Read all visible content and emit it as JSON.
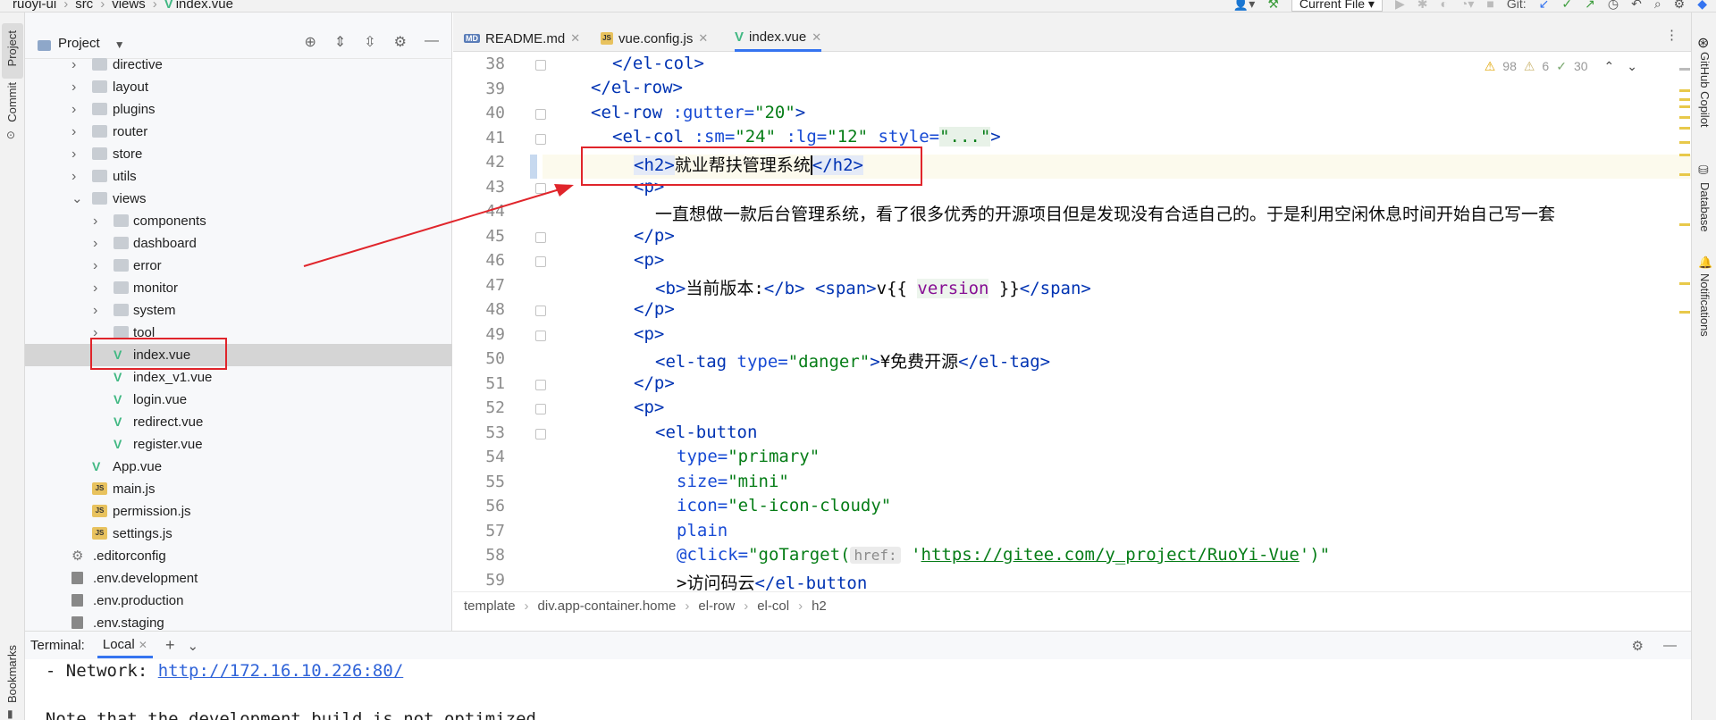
{
  "topbar": {
    "crumbs": [
      "ruoyi-ui",
      "src",
      "views",
      "index.vue"
    ],
    "run_config": "Current File",
    "git_label": "Git:"
  },
  "leftstrip": {
    "project": "Project",
    "commit": "Commit",
    "bookmarks": "Bookmarks"
  },
  "rightstrip": {
    "copilot": "GitHub Copilot",
    "database": "Database",
    "notifications": "Notifications"
  },
  "project": {
    "title": "Project",
    "tree": [
      {
        "label": "directive",
        "kind": "folder",
        "level": 1,
        "chev": "›"
      },
      {
        "label": "layout",
        "kind": "folder",
        "level": 1,
        "chev": "›"
      },
      {
        "label": "plugins",
        "kind": "folder",
        "level": 1,
        "chev": "›"
      },
      {
        "label": "router",
        "kind": "folder",
        "level": 1,
        "chev": "›"
      },
      {
        "label": "store",
        "kind": "folder",
        "level": 1,
        "chev": "›"
      },
      {
        "label": "utils",
        "kind": "folder",
        "level": 1,
        "chev": "›"
      },
      {
        "label": "views",
        "kind": "folder",
        "level": 1,
        "chev": "⌄"
      },
      {
        "label": "components",
        "kind": "folder",
        "level": 2,
        "chev": "›"
      },
      {
        "label": "dashboard",
        "kind": "folder",
        "level": 2,
        "chev": "›"
      },
      {
        "label": "error",
        "kind": "folder",
        "level": 2,
        "chev": "›"
      },
      {
        "label": "monitor",
        "kind": "folder",
        "level": 2,
        "chev": "›"
      },
      {
        "label": "system",
        "kind": "folder",
        "level": 2,
        "chev": "›"
      },
      {
        "label": "tool",
        "kind": "folder",
        "level": 2,
        "chev": "›"
      },
      {
        "label": "index.vue",
        "kind": "vue",
        "level": 2,
        "selected": true
      },
      {
        "label": "index_v1.vue",
        "kind": "vue",
        "level": 2
      },
      {
        "label": "login.vue",
        "kind": "vue",
        "level": 2
      },
      {
        "label": "redirect.vue",
        "kind": "vue",
        "level": 2
      },
      {
        "label": "register.vue",
        "kind": "vue",
        "level": 2
      },
      {
        "label": "App.vue",
        "kind": "vue",
        "level": 1
      },
      {
        "label": "main.js",
        "kind": "js",
        "level": 1
      },
      {
        "label": "permission.js",
        "kind": "js",
        "level": 1
      },
      {
        "label": "settings.js",
        "kind": "js",
        "level": 1
      },
      {
        "label": ".editorconfig",
        "kind": "gear",
        "level": 0
      },
      {
        "label": ".env.development",
        "kind": "file",
        "level": 0
      },
      {
        "label": ".env.production",
        "kind": "file",
        "level": 0
      },
      {
        "label": ".env.staging",
        "kind": "file",
        "level": 0
      }
    ]
  },
  "tabs": [
    {
      "label": "README.md",
      "icon": "md-icon",
      "active": false
    },
    {
      "label": "vue.config.js",
      "icon": "js-icon",
      "active": false
    },
    {
      "label": "index.vue",
      "icon": "vue-icon",
      "active": true
    }
  ],
  "inspections": {
    "warnings": "98",
    "weak_warnings": "6",
    "typos": "30"
  },
  "editor": {
    "line_numbers": [
      "38",
      "39",
      "40",
      "41",
      "42",
      "43",
      "44",
      "45",
      "46",
      "47",
      "48",
      "49",
      "50",
      "51",
      "52",
      "53",
      "54",
      "55",
      "56",
      "57",
      "58",
      "59"
    ],
    "lines": {
      "l38": "</el-col>",
      "l39": "</el-row>",
      "l40_tag": "<el-row",
      "l40_attr": " :gutter=",
      "l40_val": "\"20\"",
      "l40_end": ">",
      "l41_tag": "<el-col",
      "l41_attr1": " :sm=",
      "l41_val1": "\"24\"",
      "l41_attr2": " :lg=",
      "l41_val2": "\"12\"",
      "l41_attr3": " style=",
      "l41_val3": "\"...\"",
      "l41_end": ">",
      "l42_open": "<h2>",
      "l42_text": "就业帮扶管理系统",
      "l42_close": "</h2>",
      "l43": "<p>",
      "l44": "一直想做一款后台管理系统，看了很多优秀的开源项目但是发现没有合适自己的。于是利用空闲休息时间开始自己写一套",
      "l45": "</p>",
      "l46": "<p>",
      "l47_b": "<b>",
      "l47_btext": "当前版本:",
      "l47_bclose": "</b>",
      "l47_span": " <span>",
      "l47_v": "v{{ ",
      "l47_var": "version",
      "l47_vend": " }}",
      "l47_spanclose": "</span>",
      "l48": "</p>",
      "l49": "<p>",
      "l50_tag": "<el-tag",
      "l50_attr": " type=",
      "l50_val": "\"danger\"",
      "l50_gt": ">",
      "l50_text": "¥免费开源",
      "l50_close": "</el-tag>",
      "l50_end": "",
      "l51": "</p>",
      "l52": "<p>",
      "l53": "<el-button",
      "l54_attr": "type=",
      "l54_val": "\"primary\"",
      "l55_attr": "size=",
      "l55_val": "\"mini\"",
      "l56_attr": "icon=",
      "l56_val": "\"el-icon-cloudy\"",
      "l57": "plain",
      "l58_attr": "@click=",
      "l58_pre": "\"goTarget(",
      "l58_hint": "href:",
      "l58_q1": " '",
      "l58_url": "https://gitee.com/y_project/RuoYi-Vue",
      "l58_q2": "')\"",
      "l59_text": ">访问码云",
      "l59_close": "</el-button"
    }
  },
  "breadcrumb": [
    "template",
    "div.app-container.home",
    "el-row",
    "el-col",
    "h2"
  ],
  "terminal": {
    "title": "Terminal:",
    "tab": "Local",
    "line1_prefix": "  - Network: ",
    "line1_url": "http://172.16.10.226:80/",
    "line2": "  Note that the development build is not optimized."
  },
  "colors": {
    "accent": "#3574f0",
    "annotation": "#e0252b",
    "vue_green": "#41b883"
  }
}
